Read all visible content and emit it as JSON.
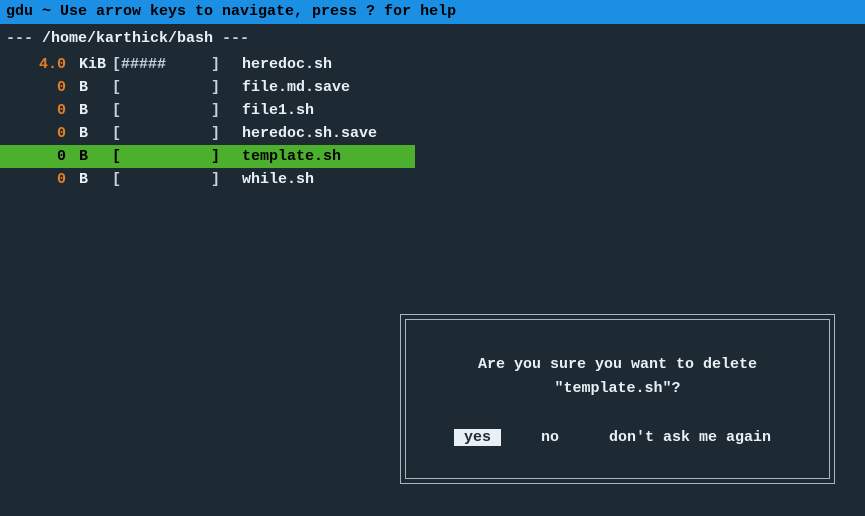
{
  "header": {
    "text": "gdu ~ Use arrow keys to navigate, press ? for help"
  },
  "path": {
    "prefix": " --- ",
    "value": "/home/karthick/bash",
    "suffix": " ---"
  },
  "files": [
    {
      "size": "4.0",
      "unit": "KiB",
      "bar": "[#####     ]",
      "name": "heredoc.sh",
      "size_color": "orange",
      "selected": false
    },
    {
      "size": "0",
      "unit": "B  ",
      "bar": "[          ]",
      "name": "file.md.save",
      "size_color": "orange",
      "selected": false
    },
    {
      "size": "0",
      "unit": "B  ",
      "bar": "[          ]",
      "name": "file1.sh",
      "size_color": "orange",
      "selected": false
    },
    {
      "size": "0",
      "unit": "B  ",
      "bar": "[          ]",
      "name": "heredoc.sh.save",
      "size_color": "orange",
      "selected": false
    },
    {
      "size": "0",
      "unit": "B  ",
      "bar": "[          ]",
      "name": "template.sh",
      "size_color": "black",
      "selected": true
    },
    {
      "size": "0",
      "unit": "B  ",
      "bar": "[          ]",
      "name": "while.sh",
      "size_color": "orange",
      "selected": false
    }
  ],
  "dialog": {
    "line1": "Are you sure you want to delete",
    "line2": "\"template.sh\"?",
    "buttons": {
      "yes": "yes",
      "no": "no",
      "dont_ask": "don't ask me again"
    }
  }
}
